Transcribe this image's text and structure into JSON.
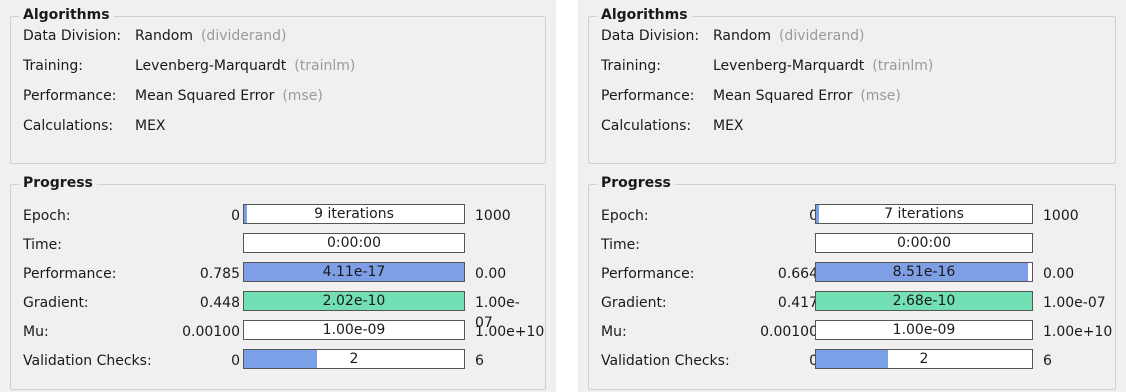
{
  "panels": [
    {
      "algorithms": {
        "title": "Algorithms",
        "rows": [
          {
            "label": "Data Division:",
            "value": "Random",
            "code": "(dividerand)"
          },
          {
            "label": "Training:",
            "value": "Levenberg-Marquardt",
            "code": "(trainlm)"
          },
          {
            "label": "Performance:",
            "value": "Mean Squared Error",
            "code": "(mse)"
          },
          {
            "label": "Calculations:",
            "value": "MEX",
            "code": ""
          }
        ]
      },
      "progress": {
        "title": "Progress",
        "rows": [
          {
            "label": "Epoch:",
            "initial": "0",
            "current": "9 iterations",
            "target": "1000",
            "fill_fraction": 0.009,
            "fill_color": "#7aa0e8"
          },
          {
            "label": "Time:",
            "initial": "",
            "current": "0:00:00",
            "target": "",
            "fill_fraction": 0,
            "fill_color": "#7aa0e8"
          },
          {
            "label": "Performance:",
            "initial": "0.785",
            "current": "4.11e-17",
            "target": "0.00",
            "fill_fraction": 1.0,
            "fill_color": "#7e9ee6"
          },
          {
            "label": "Gradient:",
            "initial": "0.448",
            "current": "2.02e-10",
            "target": "1.00e-07",
            "fill_fraction": 1.0,
            "fill_color": "#72e0b4"
          },
          {
            "label": "Mu:",
            "initial": "0.00100",
            "current": "1.00e-09",
            "target": "1.00e+10",
            "fill_fraction": 0,
            "fill_color": "#7aa0e8"
          },
          {
            "label": "Validation Checks:",
            "initial": "0",
            "current": "2",
            "target": "6",
            "fill_fraction": 0.333,
            "fill_color": "#7aa0e8"
          }
        ]
      }
    },
    {
      "algorithms": {
        "title": "Algorithms",
        "rows": [
          {
            "label": "Data Division:",
            "value": "Random",
            "code": "(dividerand)"
          },
          {
            "label": "Training:",
            "value": "Levenberg-Marquardt",
            "code": "(trainlm)"
          },
          {
            "label": "Performance:",
            "value": "Mean Squared Error",
            "code": "(mse)"
          },
          {
            "label": "Calculations:",
            "value": "MEX",
            "code": ""
          }
        ]
      },
      "progress": {
        "title": "Progress",
        "rows": [
          {
            "label": "Epoch:",
            "initial": "0",
            "current": "7 iterations",
            "target": "1000",
            "fill_fraction": 0.007,
            "fill_color": "#7aa0e8"
          },
          {
            "label": "Time:",
            "initial": "",
            "current": "0:00:00",
            "target": "",
            "fill_fraction": 0,
            "fill_color": "#7aa0e8"
          },
          {
            "label": "Performance:",
            "initial": "0.664",
            "current": "8.51e-16",
            "target": "0.00",
            "fill_fraction": 0.98,
            "fill_color": "#7e9ee6"
          },
          {
            "label": "Gradient:",
            "initial": "0.417",
            "current": "2.68e-10",
            "target": "1.00e-07",
            "fill_fraction": 1.0,
            "fill_color": "#72e0b4"
          },
          {
            "label": "Mu:",
            "initial": "0.00100",
            "current": "1.00e-09",
            "target": "1.00e+10",
            "fill_fraction": 0,
            "fill_color": "#7aa0e8"
          },
          {
            "label": "Validation Checks:",
            "initial": "0",
            "current": "2",
            "target": "6",
            "fill_fraction": 0.333,
            "fill_color": "#7aa0e8"
          }
        ]
      }
    }
  ]
}
